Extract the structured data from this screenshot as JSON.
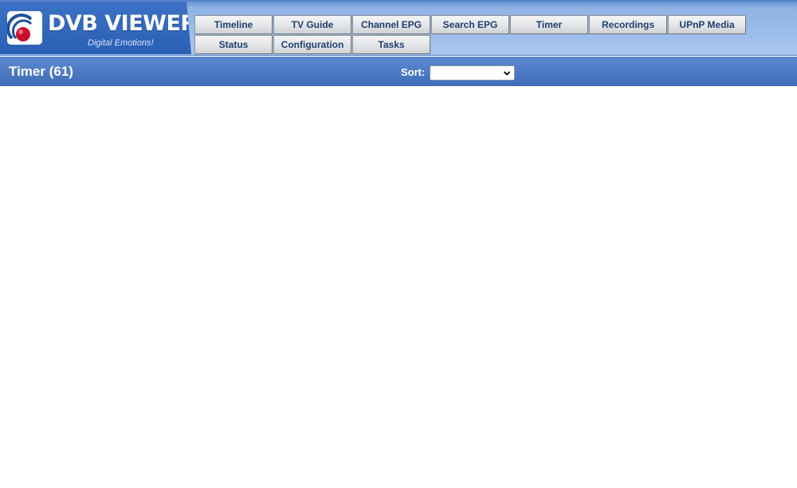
{
  "logo": {
    "title": "DVB VIEWER",
    "tagline": "Digital Emotions!",
    "icon": "dvbviewer-logo-icon"
  },
  "nav": {
    "row1": [
      {
        "label": "Timeline"
      },
      {
        "label": "TV Guide"
      },
      {
        "label": "Channel EPG"
      },
      {
        "label": "Search EPG"
      },
      {
        "label": "Timer"
      },
      {
        "label": "Recordings"
      },
      {
        "label": "UPnP Media"
      }
    ],
    "row2": [
      {
        "label": "Status"
      },
      {
        "label": "Configuration"
      },
      {
        "label": "Tasks"
      }
    ]
  },
  "titlebar": {
    "title": "Timer (61)",
    "sort_label": "Sort:",
    "sort_value": ""
  },
  "colors": {
    "header_blue": "#9cbdea",
    "titlebar_blue": "#4f7cc6",
    "nav_text": "#1f3f6e",
    "logo_red": "#c8102e"
  }
}
